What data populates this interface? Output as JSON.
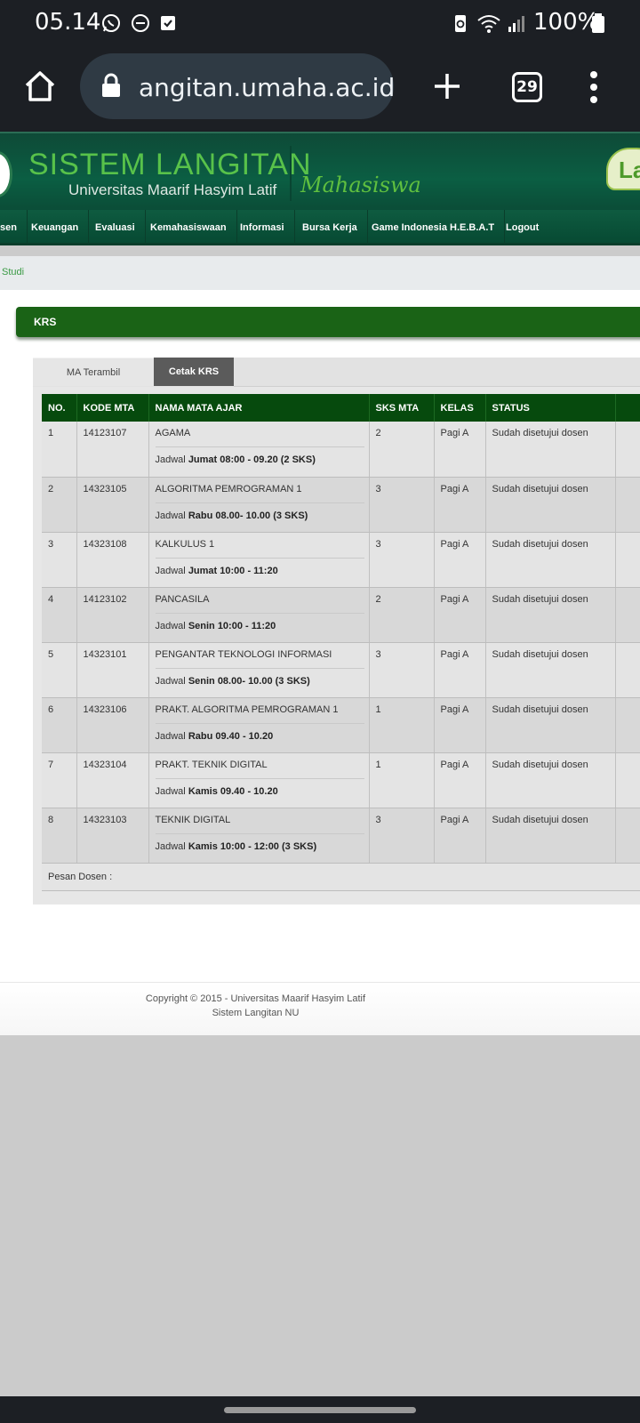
{
  "status_bar": {
    "time": "05.14",
    "battery": "100%"
  },
  "browser": {
    "url": "angitan.umaha.ac.id",
    "tab_count": "29"
  },
  "site": {
    "title": "SISTEM LANGITAN",
    "subtitle": "Universitas Maarif Hasyim Latif",
    "role": "Mahasiswa",
    "cloud_text": "La"
  },
  "nav": {
    "items": [
      "sen",
      "Keuangan",
      "Evaluasi",
      "Kemahasiswaan",
      "Informasi",
      "Bursa Kerja",
      "Game Indonesia H.E.B.A.T",
      "Logout"
    ]
  },
  "breadcrumb": "Studi",
  "section_title": "KRS",
  "tabs": {
    "ma_terambil": "MA Terambil",
    "cetak_krs": "Cetak KRS"
  },
  "table": {
    "headers": [
      "NO.",
      "KODE MTA",
      "NAMA MATA AJAR",
      "SKS MTA",
      "KELAS",
      "STATUS"
    ],
    "jadwal_prefix": "Jadwal",
    "rows": [
      {
        "no": "1",
        "kode": "14123107",
        "nama": "AGAMA",
        "jadwal": "Jumat 08:00 - 09.20 (2 SKS)",
        "sks": "2",
        "kelas": "Pagi A",
        "status": "Sudah disetujui dosen"
      },
      {
        "no": "2",
        "kode": "14323105",
        "nama": "ALGORITMA PEMROGRAMAN 1",
        "jadwal": "Rabu 08.00- 10.00 (3 SKS)",
        "sks": "3",
        "kelas": "Pagi A",
        "status": "Sudah disetujui dosen"
      },
      {
        "no": "3",
        "kode": "14323108",
        "nama": "KALKULUS 1",
        "jadwal": "Jumat 10:00 - 11:20",
        "sks": "3",
        "kelas": "Pagi A",
        "status": "Sudah disetujui dosen"
      },
      {
        "no": "4",
        "kode": "14123102",
        "nama": "PANCASILA",
        "jadwal": "Senin 10:00 - 11:20",
        "sks": "2",
        "kelas": "Pagi A",
        "status": "Sudah disetujui dosen"
      },
      {
        "no": "5",
        "kode": "14323101",
        "nama": "PENGANTAR TEKNOLOGI INFORMASI",
        "jadwal": "Senin 08.00- 10.00 (3 SKS)",
        "sks": "3",
        "kelas": "Pagi A",
        "status": "Sudah disetujui dosen"
      },
      {
        "no": "6",
        "kode": "14323106",
        "nama": "PRAKT. ALGORITMA PEMROGRAMAN 1",
        "jadwal": "Rabu 09.40 - 10.20",
        "sks": "1",
        "kelas": "Pagi A",
        "status": "Sudah disetujui dosen"
      },
      {
        "no": "7",
        "kode": "14323104",
        "nama": "PRAKT. TEKNIK DIGITAL",
        "jadwal": "Kamis 09.40 - 10.20",
        "sks": "1",
        "kelas": "Pagi A",
        "status": "Sudah disetujui dosen"
      },
      {
        "no": "8",
        "kode": "14323103",
        "nama": "TEKNIK DIGITAL",
        "jadwal": "Kamis 10:00 - 12:00 (3 SKS)",
        "sks": "3",
        "kelas": "Pagi A",
        "status": "Sudah disetujui dosen"
      }
    ],
    "pesan_dosen": "Pesan Dosen :"
  },
  "footer": {
    "line1": "Copyright © 2015 - Universitas Maarif Hasyim Latif",
    "line2": "Sistem Langitan NU"
  }
}
